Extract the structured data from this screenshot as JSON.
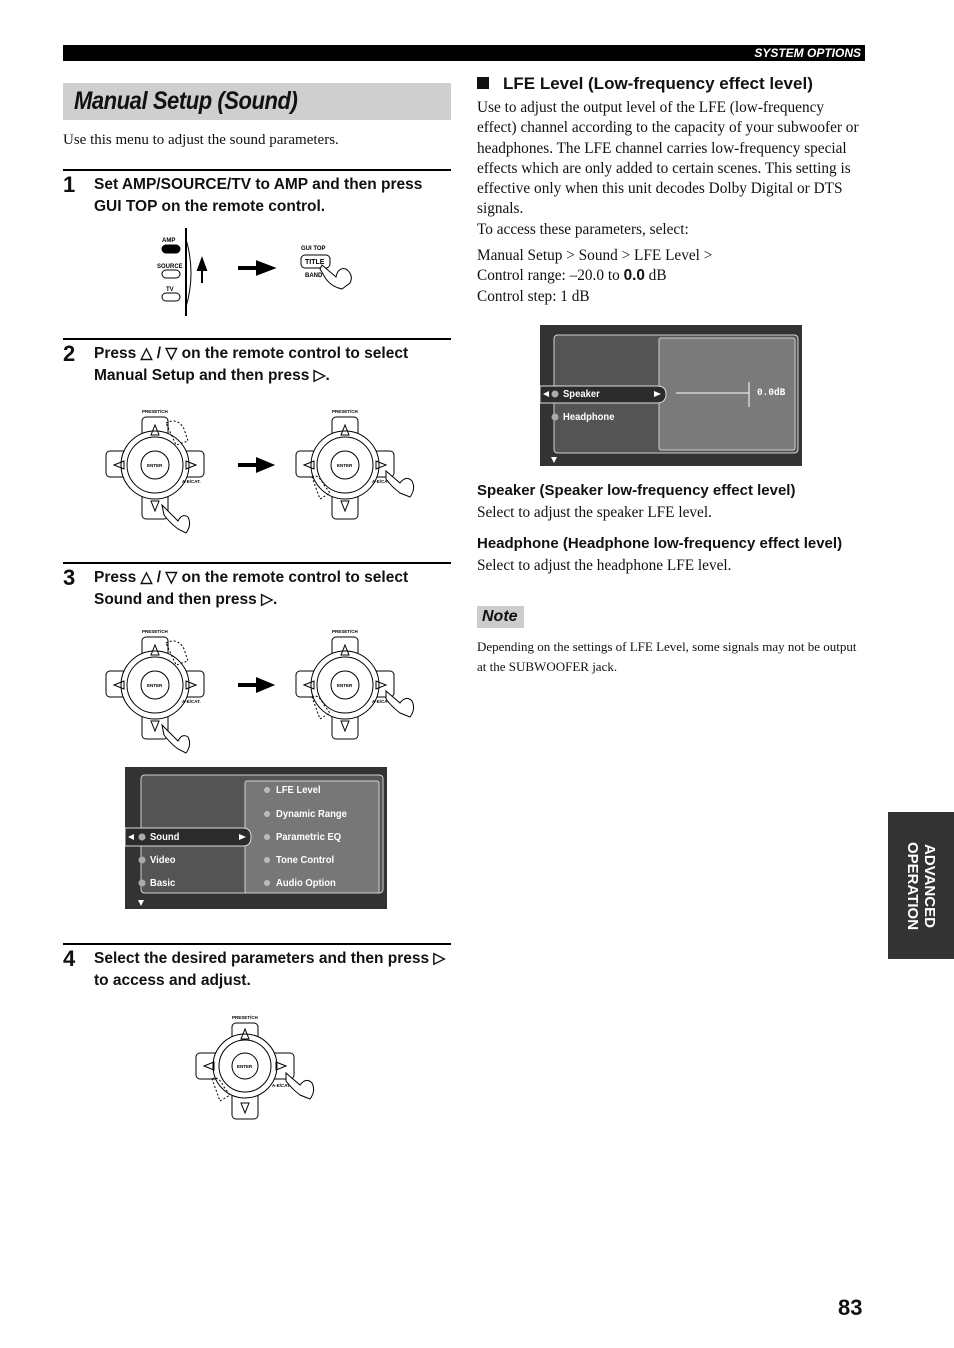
{
  "header": {
    "section": "SYSTEM OPTIONS"
  },
  "title": "Manual Setup (Sound)",
  "intro": "Use this menu to adjust the sound parameters.",
  "steps": [
    {
      "num": "1",
      "text": "Set AMP/SOURCE/TV to AMP and then press GUI TOP on the remote control."
    },
    {
      "num": "2",
      "text": "Press △ / ▽ on the remote control to select Manual Setup and then press ▷."
    },
    {
      "num": "3",
      "text": "Press △ / ▽ on the remote control to select Sound and then press ▷."
    },
    {
      "num": "4",
      "text": "Select the desired parameters and then press ▷ to access and adjust."
    }
  ],
  "remote_labels": {
    "amp": "AMP",
    "source": "SOURCE",
    "tv": "TV",
    "gui_top": "GUI TOP",
    "title": "TITLE",
    "band": "BAND",
    "preset_ch": "PRESET/CH",
    "enter": "ENTER",
    "ae_cat": "A-E/CAT."
  },
  "osd_sound_menu": {
    "left_items": [
      "Sound",
      "Video",
      "Basic"
    ],
    "selected_left": "Sound",
    "right_items": [
      "LFE Level",
      "Dynamic Range",
      "Parametric EQ",
      "Tone Control",
      "Audio Option"
    ]
  },
  "lfe_section": {
    "heading": "LFE Level (Low-frequency effect level)",
    "description": "Use to adjust the output level of the LFE (low-frequency effect) channel according to the capacity of your subwoofer or headphones. The LFE channel carries low-frequency special effects which are only added to certain scenes. This setting is effective only when this unit decodes Dolby Digital or DTS signals.",
    "access_line": "To access these parameters, select:",
    "path": "Manual Setup > Sound > LFE Level >",
    "range_prefix": "Control range: –20.0 to ",
    "range_default": "0.0",
    "range_suffix": " dB",
    "step": "Control step: 1 dB"
  },
  "osd_lfe": {
    "left_items": [
      "Speaker",
      "Headphone"
    ],
    "selected_left": "Speaker",
    "value": "0.0dB"
  },
  "params": [
    {
      "heading": "Speaker (Speaker low-frequency effect level)",
      "text": "Select to adjust the speaker LFE level."
    },
    {
      "heading": "Headphone (Headphone low-frequency effect level)",
      "text": "Select to adjust the headphone LFE level."
    }
  ],
  "note": {
    "label": "Note",
    "text": "Depending on the settings of LFE Level, some signals may not be output at the SUBWOOFER jack."
  },
  "side_tab": "ADVANCED OPERATION",
  "page_number": "83"
}
